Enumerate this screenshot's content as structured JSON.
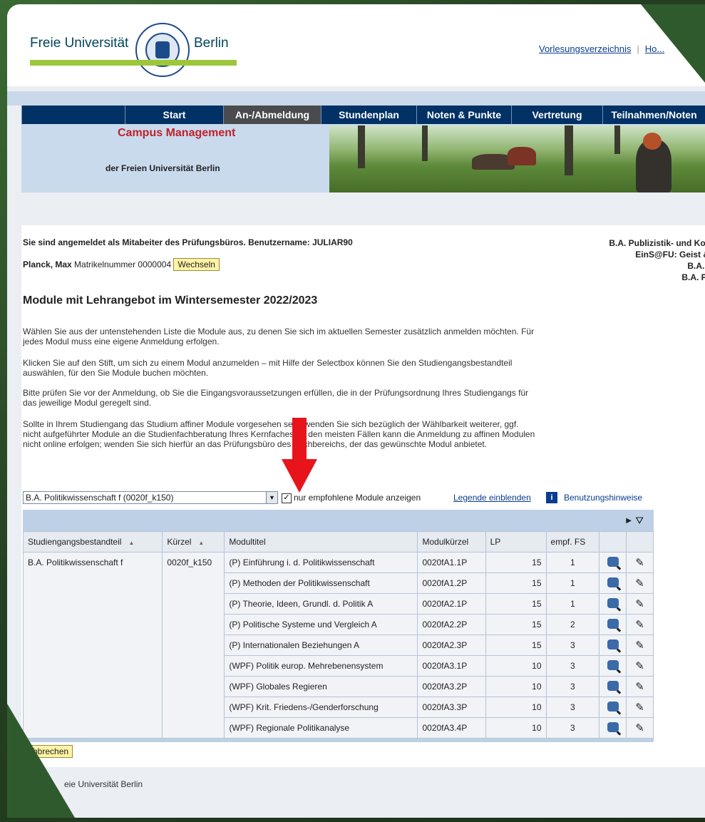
{
  "header": {
    "logo_left": "Freie Universität",
    "logo_right": "Berlin",
    "top_link_1": "Vorlesungsverzeichnis",
    "top_link_2": "Ho..."
  },
  "nav": {
    "items": [
      {
        "label": "",
        "width": 145
      },
      {
        "label": "Start",
        "width": 138
      },
      {
        "label": "An-/Abmeldung",
        "width": 137,
        "active": true
      },
      {
        "label": "Stundenplan",
        "width": 134
      },
      {
        "label": "Noten & Punkte",
        "width": 133
      },
      {
        "label": "Vertretung",
        "width": 128
      },
      {
        "label": "Teilnahmen/Noten",
        "width": 144
      }
    ]
  },
  "campus": {
    "title": "Campus Management",
    "subtitle": "der Freien Universität Berlin"
  },
  "session": {
    "login_text": "Sie sind angemeldet als Mitabeiter des Prüfungsbüros. Benutzername: JULIAR90",
    "student_name": "Planck, Max",
    "matrikel_label": "Matrikelnummer 0000004",
    "switch_button": "Wechseln"
  },
  "programs": [
    "B.A. Publizistik- und Kommuni",
    "EinS@FU: Geist & Kultu",
    "B.A. Frankr",
    "B.A. Politikw"
  ],
  "page": {
    "heading": "Module mit Lehrangebot im Wintersemester 2022/2023",
    "para1": "Wählen Sie aus der untenstehenden Liste die Module aus, zu denen Sie sich im aktuellen Semester zusätzlich anmelden möchten. Für jedes Modul muss eine eigene Anmeldung erfolgen.",
    "para2": "Klicken Sie auf den Stift, um sich zu einem Modul anzumelden – mit Hilfe der Selectbox können Sie den Studiengangsbestandteil auswählen, für den Sie Module buchen möchten.",
    "para3": "Bitte prüfen Sie vor der Anmeldung, ob Sie die Eingangsvoraussetzungen erfüllen, die in der Prüfungsordnung Ihres Studiengangs für das jeweilige Modul geregelt sind.",
    "para4": "Sollte in Ihrem Studiengang das Studium affiner Module vorgesehen sein, wenden Sie sich bezüglich der Wählbarkeit weiterer, ggf. nicht aufgeführter Module an die Studienfachberatung Ihres Kernfaches. In den meisten Fällen kann die Anmeldung zu affinen Modulen nicht online erfolgen; wenden Sie sich hierfür an das Prüfungsbüro des Fachbereichs, der das gewünschte Modul anbietet."
  },
  "filters": {
    "select_value": "B.A. Politikwissenschaft f (0020f_k150)",
    "checkbox_label": "nur empfohlene Module anzeigen",
    "legend_link": "Legende einblenden",
    "help_link": "Benutzungshinweise"
  },
  "table": {
    "headers": [
      "Studiengangsbestandteil",
      "Kürzel",
      "Modultitel",
      "Modulkürzel",
      "LP",
      "empf. FS",
      "",
      ""
    ],
    "group": {
      "bestandteil": "B.A. Politikwissenschaft f",
      "kuerzel": "0020f_k150"
    },
    "rows": [
      {
        "titel": "(P) Einführung i. d. Politikwissenschaft",
        "modulkuerzel": "0020fA1.1P",
        "lp": "15",
        "fs": "1"
      },
      {
        "titel": "(P) Methoden der Politikwissenschaft",
        "modulkuerzel": "0020fA1.2P",
        "lp": "15",
        "fs": "1"
      },
      {
        "titel": "(P) Theorie, Ideen, Grundl. d. Politik A",
        "modulkuerzel": "0020fA2.1P",
        "lp": "15",
        "fs": "1"
      },
      {
        "titel": "(P) Politische Systeme und Vergleich A",
        "modulkuerzel": "0020fA2.2P",
        "lp": "15",
        "fs": "2"
      },
      {
        "titel": "(P) Internationalen Beziehungen A",
        "modulkuerzel": "0020fA2.3P",
        "lp": "15",
        "fs": "3"
      },
      {
        "titel": "(WPF) Politik europ. Mehrebenensystem",
        "modulkuerzel": "0020fA3.1P",
        "lp": "10",
        "fs": "3"
      },
      {
        "titel": "(WPF) Globales Regieren",
        "modulkuerzel": "0020fA3.2P",
        "lp": "10",
        "fs": "3"
      },
      {
        "titel": "(WPF) Krit. Friedens-/Genderforschung",
        "modulkuerzel": "0020fA3.3P",
        "lp": "10",
        "fs": "3"
      },
      {
        "titel": "(WPF) Regionale Politikanalyse",
        "modulkuerzel": "0020fA3.4P",
        "lp": "10",
        "fs": "3"
      }
    ]
  },
  "cancel_button": "Abbrechen",
  "footer": "eie Universität Berlin",
  "colors": {
    "nav": "#013165",
    "accent_red": "#c0212e",
    "green_bar": "#9dc73b"
  }
}
